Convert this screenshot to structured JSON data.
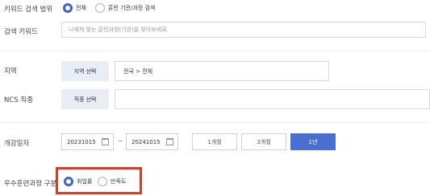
{
  "keyword_scope": {
    "label": "키워드 검색 범위",
    "options": [
      {
        "label": "전체",
        "checked": true
      },
      {
        "label": "훈련 기관/과정 검색",
        "checked": false
      }
    ]
  },
  "keyword": {
    "label": "검색 키워드",
    "placeholder": "나에게 맞는 훈련과정(기관)을 찾아보세요."
  },
  "region": {
    "label": "지역",
    "button": "지역 선택",
    "value": "전국 > 전체"
  },
  "ncs": {
    "label": "NCS 직종",
    "button": "직종 선택",
    "value": ""
  },
  "start_date": {
    "label": "개강일자",
    "from": "20231015",
    "separator": "~",
    "to": "20241015",
    "periods": [
      {
        "label": "1개월",
        "active": false
      },
      {
        "label": "3개월",
        "active": false
      },
      {
        "label": "1년",
        "active": true
      }
    ]
  },
  "excellent": {
    "label": "우수훈련과정 구분",
    "options": [
      {
        "label": "취업률",
        "checked": true
      },
      {
        "label": "만족도",
        "checked": false
      }
    ],
    "highlight_color": "#e73620"
  },
  "colors": {
    "accent": "#3d64c8",
    "active_button": "#4a6fd3",
    "grey_button": "#e9edf5"
  }
}
